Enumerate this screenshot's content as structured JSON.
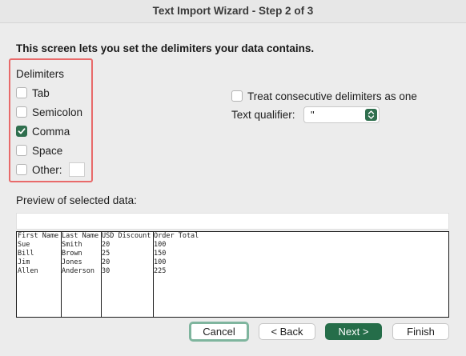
{
  "window": {
    "title": "Text Import Wizard - Step 2 of 3"
  },
  "intro": "This screen lets you set the delimiters your data contains.",
  "delimiters": {
    "label": "Delimiters",
    "options": [
      {
        "label": "Tab",
        "checked": false
      },
      {
        "label": "Semicolon",
        "checked": false
      },
      {
        "label": "Comma",
        "checked": true
      },
      {
        "label": "Space",
        "checked": false
      },
      {
        "label": "Other:",
        "checked": false,
        "value": ""
      }
    ]
  },
  "consecutive": {
    "label": "Treat consecutive delimiters as one",
    "checked": false
  },
  "qualifier": {
    "label": "Text qualifier:",
    "value": "\""
  },
  "preview": {
    "label": "Preview of selected data:",
    "columns": [
      {
        "header": "First Name",
        "values": [
          "Sue",
          "Bill",
          "Jim",
          "Allen"
        ]
      },
      {
        "header": "Last Name",
        "values": [
          "Smith",
          "Brown",
          "Jones",
          "Anderson"
        ]
      },
      {
        "header": "USD Discount",
        "values": [
          "20",
          "25",
          "20",
          "30"
        ]
      },
      {
        "header": "Order Total",
        "values": [
          "100",
          "150",
          "100",
          "225"
        ]
      }
    ]
  },
  "buttons": {
    "cancel": "Cancel",
    "back": "< Back",
    "next": "Next >",
    "finish": "Finish"
  },
  "colors": {
    "accent": "#256d49",
    "highlight": "#e86a6a"
  }
}
